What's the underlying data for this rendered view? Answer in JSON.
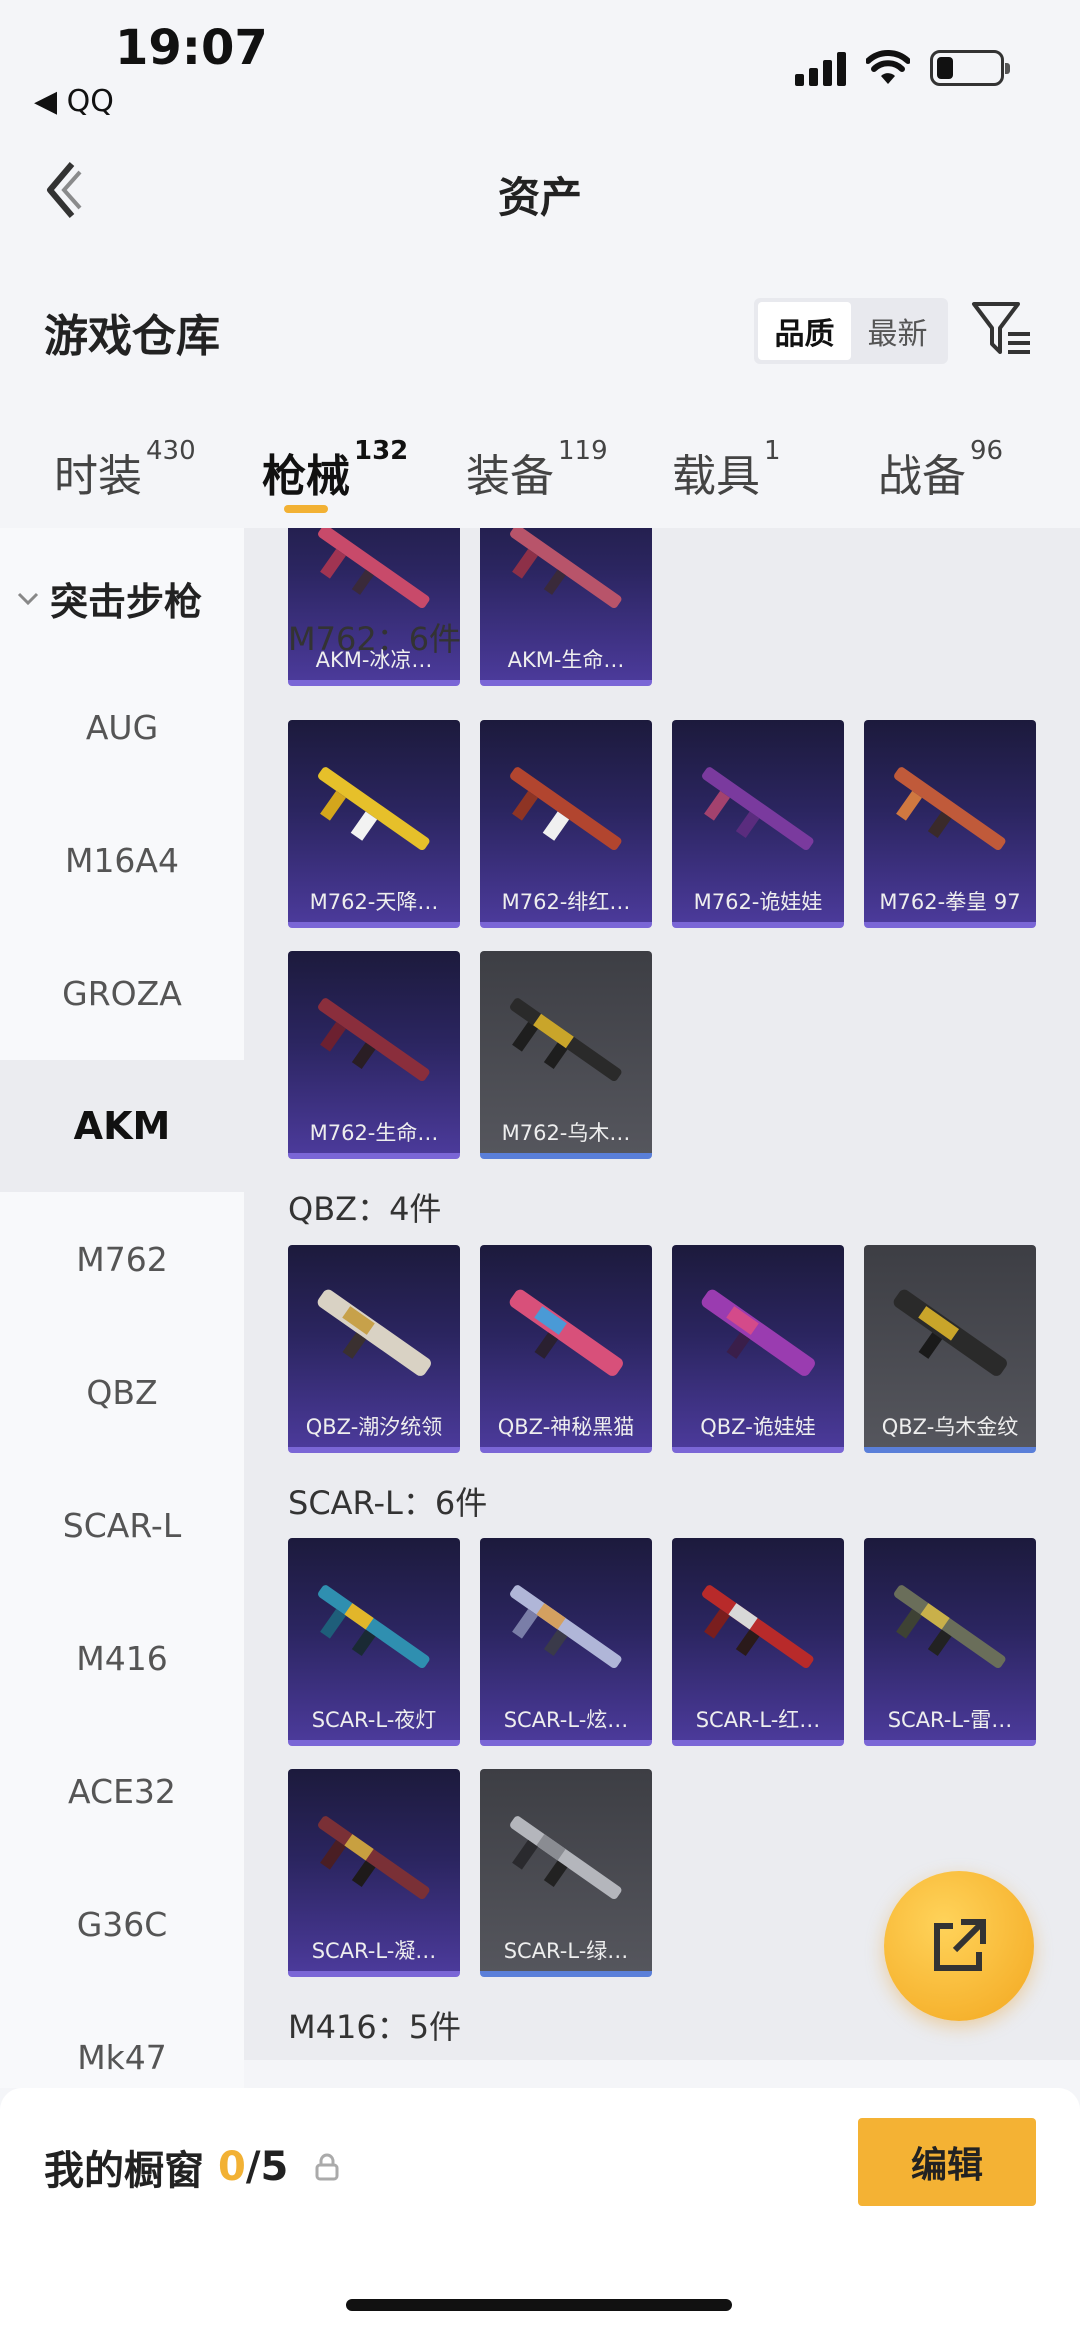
{
  "status": {
    "time": "19:07",
    "back_app": "◀ QQ"
  },
  "nav": {
    "title": "资产"
  },
  "header": {
    "title": "游戏仓库",
    "sort_options": [
      "品质",
      "最新"
    ]
  },
  "tabs": [
    {
      "label": "时装",
      "count": "430"
    },
    {
      "label": "枪械",
      "count": "132"
    },
    {
      "label": "装备",
      "count": "119"
    },
    {
      "label": "载具",
      "count": "1"
    },
    {
      "label": "战备",
      "count": "96"
    }
  ],
  "sidebar": {
    "group": "突击步枪",
    "items": [
      "AUG",
      "M16A4",
      "GROZA",
      "AKM",
      "M762",
      "QBZ",
      "SCAR-L",
      "M416",
      "ACE32",
      "G36C",
      "Mk47"
    ]
  },
  "sections": {
    "akm_cards": [
      "AKM-冰凉…",
      "AKM-生命…"
    ],
    "m762": {
      "title": "M762：6件",
      "cards": [
        "M762-天降…",
        "M762-绯红…",
        "M762-诡娃娃",
        "M762-拳皇 97",
        "M762-生命…",
        "M762-乌木…"
      ]
    },
    "qbz": {
      "title": "QBZ：4件",
      "cards": [
        "QBZ-潮汐统领",
        "QBZ-神秘黑猫",
        "QBZ-诡娃娃",
        "QBZ-乌木金纹"
      ]
    },
    "scar": {
      "title": "SCAR-L：6件",
      "cards": [
        "SCAR-L-夜灯",
        "SCAR-L-炫…",
        "SCAR-L-红…",
        "SCAR-L-雷…",
        "SCAR-L-凝…",
        "SCAR-L-绿…"
      ]
    },
    "m416": {
      "title": "M416：5件"
    }
  },
  "bottom": {
    "showcase_label": "我的橱窗",
    "current": "0",
    "total": "/5",
    "edit_label": "编辑"
  },
  "colors": {
    "accent": "#f2b134",
    "card_purple": "#2b2560",
    "card_grey": "#55565d"
  }
}
